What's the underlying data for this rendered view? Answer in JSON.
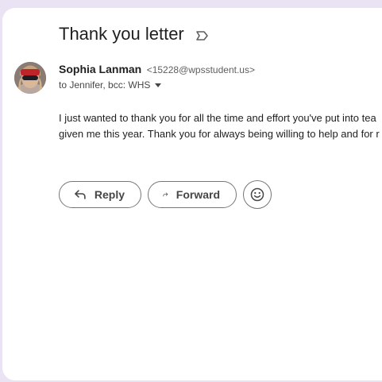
{
  "email": {
    "subject": "Thank you letter",
    "sender": {
      "name": "Sophia Lanman",
      "email": "<15228@wpsstudent.us>"
    },
    "recipients": "to Jennifer, bcc: WHS",
    "body_lines": [
      "I just wanted to thank you for all the time and effort you've put into tea",
      "given me this year. Thank you for always being willing to help and for r"
    ]
  },
  "actions": {
    "reply_label": "Reply",
    "forward_label": "Forward"
  },
  "icons": {
    "label": "label-outline-icon",
    "recipients_toggle": "caret-down-icon",
    "reply": "reply-arrow-icon",
    "forward": "forward-arrow-icon",
    "emoji": "emoji-smile-icon"
  },
  "colors": {
    "background": "#e9e3f3",
    "panel": "#ffffff",
    "text": "#1f1f1f",
    "muted": "#5e5e5e",
    "button_border": "#747775"
  }
}
